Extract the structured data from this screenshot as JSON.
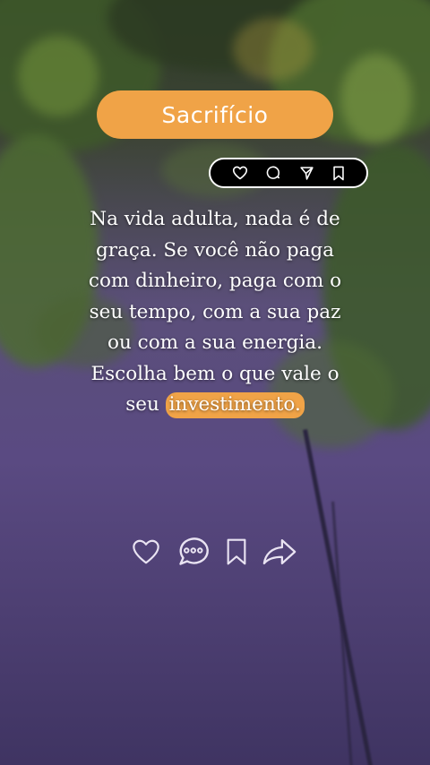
{
  "post": {
    "title": "Sacrifício",
    "quote_lines": [
      "Na vida adulta, nada é de",
      "graça. Se você não paga",
      "com dinheiro, paga com o",
      "seu tempo, com a sua paz",
      "ou com a sua energia.",
      "Escolha bem o que vale o"
    ],
    "last_line_prefix": "seu ",
    "highlighted_word": "investimento."
  },
  "top_actions": {
    "icons": [
      "heart-icon",
      "comment-icon",
      "send-icon",
      "bookmark-icon"
    ]
  },
  "bottom_actions": {
    "icons": [
      "heart-icon",
      "comment-dots-icon",
      "bookmark-icon",
      "share-arrow-icon"
    ]
  },
  "colors": {
    "accent": "#f0a347",
    "text": "#ffffff",
    "pill_background": "#000000",
    "background_purple": "#5a4a82"
  }
}
